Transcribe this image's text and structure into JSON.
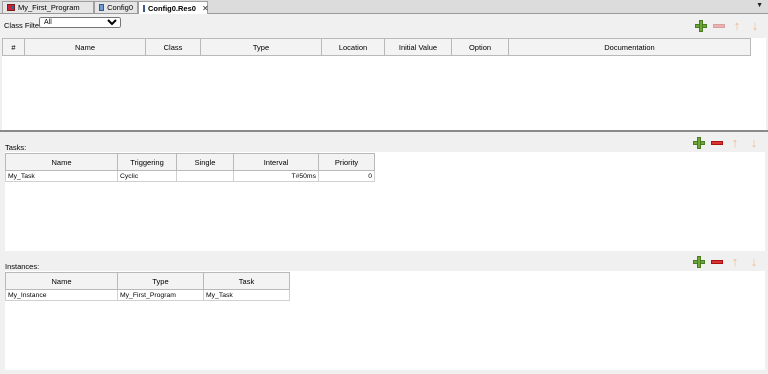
{
  "tabs": [
    {
      "label": "My_First_Program",
      "icon": "program-icon",
      "active": false
    },
    {
      "label": "Config0",
      "icon": "config-icon",
      "active": false
    },
    {
      "label": "Config0.Res0",
      "icon": "resource-icon",
      "active": true,
      "close": "✕"
    }
  ],
  "tab_dropdown": "▼",
  "variables": {
    "class_filter_label": "Class Filter:",
    "class_filter_value": "All",
    "columns": [
      "#",
      "Name",
      "Class",
      "Type",
      "Location",
      "Initial Value",
      "Option",
      "Documentation"
    ]
  },
  "tasks": {
    "label": "Tasks:",
    "columns": [
      "Name",
      "Triggering",
      "Single",
      "Interval",
      "Priority"
    ],
    "rows": [
      [
        "My_Task",
        "Cyclic",
        "",
        "T#50ms",
        "0"
      ]
    ]
  },
  "instances": {
    "label": "Instances:",
    "columns": [
      "Name",
      "Type",
      "Task"
    ],
    "rows": [
      [
        "My_Instance",
        "My_First_Program",
        "My_Task"
      ]
    ]
  },
  "toolbar_icons": [
    "add-icon",
    "remove-icon",
    "move-up-icon",
    "move-down-icon"
  ]
}
